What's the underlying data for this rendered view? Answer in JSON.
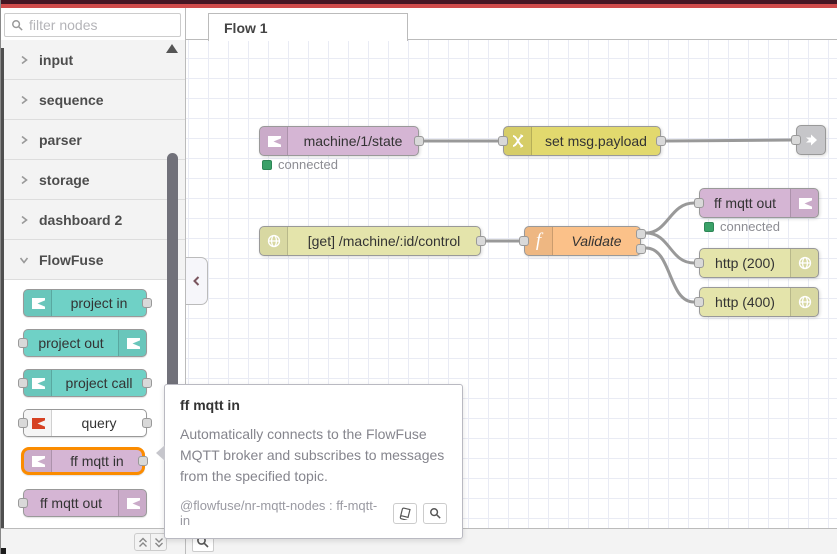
{
  "palette": {
    "filter_placeholder": "filter nodes",
    "categories": [
      {
        "label": "input",
        "state": "collapsed"
      },
      {
        "label": "sequence",
        "state": "collapsed"
      },
      {
        "label": "parser",
        "state": "collapsed"
      },
      {
        "label": "storage",
        "state": "collapsed"
      },
      {
        "label": "dashboard 2",
        "state": "collapsed"
      },
      {
        "label": "FlowFuse",
        "state": "expanded"
      }
    ],
    "nodes": [
      {
        "label": "project in",
        "color": "#6fd1c6",
        "ports": "right"
      },
      {
        "label": "project out",
        "color": "#6fd1c6",
        "ports": "left"
      },
      {
        "label": "project call",
        "color": "#6fd1c6",
        "ports": "both"
      },
      {
        "label": "query",
        "color": "#ffffff",
        "ports": "both"
      },
      {
        "label": "ff mqtt in",
        "color": "#d5b5d4",
        "ports": "right",
        "highlighted": true
      },
      {
        "label": "ff mqtt out",
        "color": "#d5b5d4",
        "ports": "left"
      }
    ]
  },
  "tabs": [
    {
      "label": "Flow 1",
      "active": true
    }
  ],
  "canvas": {
    "nodes": {
      "mqtt_in": {
        "label": "machine/1/state",
        "status": "connected",
        "color": "#d5b5d4"
      },
      "change": {
        "label": "set msg.payload",
        "color": "#e2d96e"
      },
      "link_out": {
        "label": "",
        "color": "#c6c6c9"
      },
      "http_in": {
        "label": "[get] /machine/:id/control",
        "color": "#e4e4ab"
      },
      "function": {
        "label": "Validate",
        "color": "#fbc189"
      },
      "mqtt_out": {
        "label": "ff mqtt out",
        "status": "connected",
        "color": "#d5b5d4"
      },
      "http_200": {
        "label": "http (200)",
        "color": "#e4e4ab"
      },
      "http_400": {
        "label": "http (400)",
        "color": "#e4e4ab"
      }
    }
  },
  "tooltip": {
    "title": "ff mqtt in",
    "body": "Automatically connects to the FlowFuse MQTT broker and subscribes to messages from the specified topic.",
    "module": "@flowfuse/nr-mqtt-nodes : ff-mqtt-in"
  },
  "colors": {
    "header_red": "#cf4b4b",
    "header_maroon": "#451623",
    "flowfuse_teal": "#6fd1c6",
    "mqtt_mauve": "#d5b5d4",
    "change_yellow": "#e2d96e",
    "http_khaki": "#e4e4ab",
    "function_orange": "#fbc189",
    "link_gray": "#c6c6c9",
    "hover_highlight": "#fb8c00",
    "status_green": "#3aa168"
  }
}
